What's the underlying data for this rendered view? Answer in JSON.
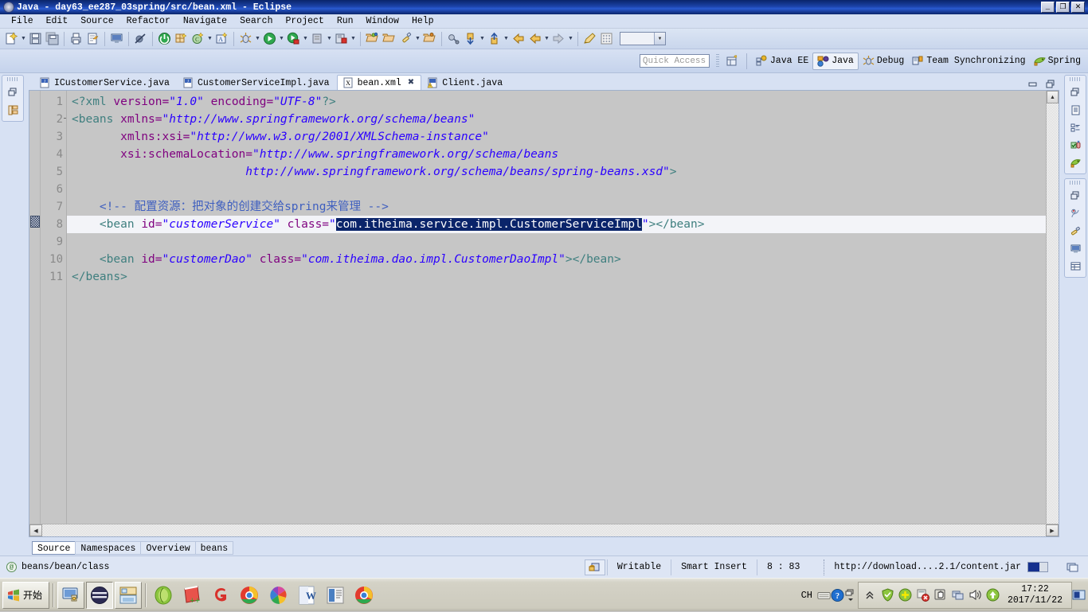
{
  "window": {
    "title": "Java - day63_ee287_03spring/src/bean.xml - Eclipse",
    "minimize": "_",
    "maximize": "❐",
    "close": "✕"
  },
  "menubar": {
    "items": [
      "File",
      "Edit",
      "Source",
      "Refactor",
      "Navigate",
      "Search",
      "Project",
      "Run",
      "Window",
      "Help"
    ]
  },
  "toolbar": {
    "groups": [
      {
        "buttons": [
          {
            "name": "new-wizard-icon",
            "arrow": true
          },
          {
            "name": "save-icon",
            "arrow": false
          },
          {
            "name": "save-all-icon",
            "arrow": false
          }
        ]
      },
      {
        "buttons": [
          {
            "name": "print-icon",
            "arrow": false
          },
          {
            "name": "export-icon",
            "arrow": false
          }
        ]
      },
      {
        "buttons": [
          {
            "name": "console-icon",
            "arrow": false
          }
        ]
      },
      {
        "buttons": [
          {
            "name": "skip-breakpoints-icon",
            "arrow": false
          }
        ]
      },
      {
        "buttons": [
          {
            "name": "terminate-icon",
            "arrow": false
          },
          {
            "name": "new-java-package-icon",
            "arrow": false
          },
          {
            "name": "new-class-icon",
            "arrow": true
          },
          {
            "name": "new-annotation-icon",
            "arrow": false
          }
        ]
      },
      {
        "buttons": [
          {
            "name": "debug-icon",
            "arrow": true
          },
          {
            "name": "run-icon",
            "arrow": true
          },
          {
            "name": "run-external-tools-icon",
            "arrow": true
          },
          {
            "name": "coverage-icon",
            "arrow": true
          },
          {
            "name": "run-server-icon",
            "arrow": true
          }
        ]
      },
      {
        "buttons": [
          {
            "name": "open-type-icon",
            "arrow": false
          },
          {
            "name": "open-task-icon",
            "arrow": false
          },
          {
            "name": "search-icon",
            "arrow": true
          },
          {
            "name": "open-resource-icon",
            "arrow": false
          }
        ]
      },
      {
        "buttons": [
          {
            "name": "link-editor-icon",
            "arrow": false
          },
          {
            "name": "next-annotation-icon",
            "arrow": true
          },
          {
            "name": "previous-annotation-icon",
            "arrow": true
          },
          {
            "name": "back-icon",
            "arrow": false
          },
          {
            "name": "forward-back-icon",
            "arrow": true
          },
          {
            "name": "forward-icon",
            "arrow": true
          }
        ]
      },
      {
        "buttons": [
          {
            "name": "pencil-icon",
            "arrow": false
          },
          {
            "name": "grid-icon",
            "arrow": false
          }
        ]
      }
    ]
  },
  "quick_access": {
    "placeholder": "Quick Access",
    "value": ""
  },
  "perspectives": {
    "open_perspective_icon": "open-perspective-icon",
    "items": [
      {
        "label": "Java EE",
        "icon": "java-ee-perspective-icon",
        "active": false
      },
      {
        "label": "Java",
        "icon": "java-perspective-icon",
        "active": true
      },
      {
        "label": "Debug",
        "icon": "debug-perspective-icon",
        "active": false
      },
      {
        "label": "Team Synchronizing",
        "icon": "team-sync-perspective-icon",
        "active": false
      },
      {
        "label": "Spring",
        "icon": "spring-perspective-icon",
        "active": false
      }
    ]
  },
  "left_stack": {
    "icons": [
      "restore-view-icon",
      "package-explorer-icon"
    ]
  },
  "right_stack_top": {
    "icons": [
      "restore-view-icon",
      "outline-icon",
      "task-list-icon",
      "junit-icon",
      "spring-explorer-icon"
    ]
  },
  "right_stack_bottom": {
    "icons": [
      "restore-view-icon",
      "problems-icon",
      "javadoc-icon",
      "console-icon",
      "servers-icon"
    ]
  },
  "editor": {
    "tabs": [
      {
        "label": "ICustomerService.java",
        "icon": "java-file-icon",
        "active": false,
        "closable": false
      },
      {
        "label": "CustomerServiceImpl.java",
        "icon": "java-file-icon",
        "active": false,
        "closable": false
      },
      {
        "label": "bean.xml",
        "icon": "xml-file-icon",
        "active": true,
        "closable": true,
        "close_glyph": "✖"
      },
      {
        "label": "Client.java",
        "icon": "java-file-warning-icon",
        "active": false,
        "closable": false
      }
    ],
    "tab_controls": {
      "minimize": "▁",
      "maximize": "❐"
    },
    "line_numbers": [
      "1",
      "2",
      "3",
      "4",
      "5",
      "6",
      "7",
      "8",
      "9",
      "10",
      "11"
    ],
    "current_line": 8,
    "folding_lines": [
      2
    ],
    "scroll": {
      "up_arrow": "▲",
      "down_arrow": "▼",
      "left_arrow": "◀",
      "right_arrow": "▶"
    },
    "bottom_tabs": [
      {
        "label": "Source",
        "active": true
      },
      {
        "label": "Namespaces",
        "active": false
      },
      {
        "label": "Overview",
        "active": false
      },
      {
        "label": "beans",
        "active": false
      }
    ],
    "code": [
      {
        "line": 1,
        "tokens": [
          {
            "t": "<?xml ",
            "c": "pi"
          },
          {
            "t": "version=",
            "c": "attr"
          },
          {
            "t": "\"1.0\"",
            "c": "val"
          },
          {
            "t": " ",
            "c": "plain"
          },
          {
            "t": "encoding=",
            "c": "attr"
          },
          {
            "t": "\"UTF-8\"",
            "c": "val"
          },
          {
            "t": "?>",
            "c": "pi"
          }
        ]
      },
      {
        "line": 2,
        "tokens": [
          {
            "t": "<beans",
            "c": "tag"
          },
          {
            "t": " ",
            "c": "plain"
          },
          {
            "t": "xmlns=",
            "c": "attr"
          },
          {
            "t": "\"http://www.springframework.org/schema/beans\"",
            "c": "val"
          }
        ]
      },
      {
        "line": 3,
        "tokens": [
          {
            "t": "       ",
            "c": "plain"
          },
          {
            "t": "xmlns:xsi=",
            "c": "attr"
          },
          {
            "t": "\"http://www.w3.org/2001/XMLSchema-instance\"",
            "c": "val"
          }
        ]
      },
      {
        "line": 4,
        "tokens": [
          {
            "t": "       ",
            "c": "plain"
          },
          {
            "t": "xsi:schemaLocation=",
            "c": "attr"
          },
          {
            "t": "\"http://www.springframework.org/schema/beans",
            "c": "val"
          }
        ]
      },
      {
        "line": 5,
        "tokens": [
          {
            "t": "                         ",
            "c": "plain"
          },
          {
            "t": "http://www.springframework.org/schema/beans/spring-beans.xsd\"",
            "c": "val"
          },
          {
            "t": ">",
            "c": "tag"
          }
        ]
      },
      {
        "line": 6,
        "tokens": []
      },
      {
        "line": 7,
        "tokens": [
          {
            "t": "    ",
            "c": "plain"
          },
          {
            "t": "<!-- 配置资源：把对象的创建交给spring来管理 -->",
            "c": "comment"
          }
        ]
      },
      {
        "line": 8,
        "tokens": [
          {
            "t": "    ",
            "c": "plain"
          },
          {
            "t": "<bean",
            "c": "tag"
          },
          {
            "t": " ",
            "c": "plain"
          },
          {
            "t": "id=",
            "c": "attr"
          },
          {
            "t": "\"customerService\"",
            "c": "val"
          },
          {
            "t": " ",
            "c": "plain"
          },
          {
            "t": "class=",
            "c": "attr"
          },
          {
            "t": "\"",
            "c": "val"
          },
          {
            "t": "com.itheima.service.impl.CustomerServiceImpl",
            "c": "sel"
          },
          {
            "t": "\"",
            "c": "val"
          },
          {
            "t": ">",
            "c": "tag"
          },
          {
            "t": "</bean>",
            "c": "tag"
          }
        ]
      },
      {
        "line": 9,
        "tokens": []
      },
      {
        "line": 10,
        "tokens": [
          {
            "t": "    ",
            "c": "plain"
          },
          {
            "t": "<bean",
            "c": "tag"
          },
          {
            "t": " ",
            "c": "plain"
          },
          {
            "t": "id=",
            "c": "attr"
          },
          {
            "t": "\"customerDao\"",
            "c": "val"
          },
          {
            "t": " ",
            "c": "plain"
          },
          {
            "t": "class=",
            "c": "attr"
          },
          {
            "t": "\"com.itheima.dao.impl.CustomerDaoImpl\"",
            "c": "val"
          },
          {
            "t": ">",
            "c": "tag"
          },
          {
            "t": "</bean>",
            "c": "tag"
          }
        ]
      },
      {
        "line": 11,
        "tokens": [
          {
            "t": "</beans>",
            "c": "tag"
          }
        ]
      }
    ]
  },
  "statusbar": {
    "selection_path": "beans/bean/class",
    "writable": "Writable",
    "insert_mode": "Smart Insert",
    "position": "8 : 83",
    "download": "http://download....2.1/content.jar",
    "progress_percent": 50
  },
  "taskbar": {
    "start_label": "开始",
    "quick_launch": [
      "show-desktop-icon",
      "eclipse-window-icon",
      "file-explorer-icon"
    ],
    "windows": [
      "navicat-icon",
      "notepadpp-icon",
      "gg-icon",
      "chrome-icon",
      "chrome-canary-icon",
      "word-icon",
      "reader-icon",
      "chrome2-icon"
    ],
    "tray": {
      "ime": "CH",
      "ime_keyboard_icon": "keyboard-icon",
      "help_icon": "help-icon",
      "expand_icon": "expand-tray-icon",
      "icons": [
        "chevron-up-icon",
        "shield-icon",
        "plus-green-icon",
        "flag-remove-icon",
        "hand-icon",
        "network-icon",
        "volume-icon",
        "update-icon"
      ],
      "time": "17:22",
      "date": "2017/11/22",
      "show-desktop": "show-desktop-button"
    }
  }
}
